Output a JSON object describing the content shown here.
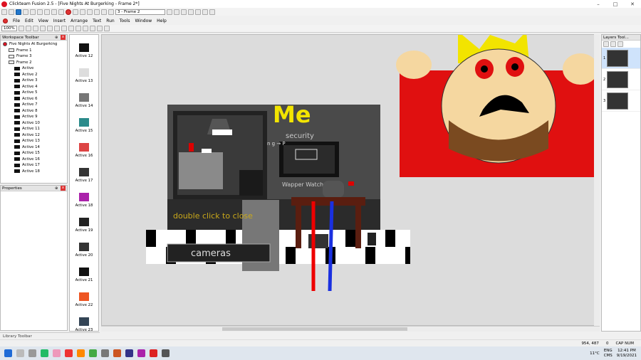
{
  "window": {
    "title": "Clickteam Fusion 2.5 - [Five Nights At Burgerking - Frame 2*]"
  },
  "toolbar": {
    "frame_select": "3 - Frame 2",
    "zoom": "100%"
  },
  "menu": [
    "File",
    "Edit",
    "View",
    "Insert",
    "Arrange",
    "Text",
    "Run",
    "Tools",
    "Window",
    "Help"
  ],
  "workspace": {
    "title": "Workspace Toolbar",
    "items": [
      {
        "label": "Five Nights At Burgerking",
        "kind": "app",
        "indent": 0
      },
      {
        "label": "Frame 1",
        "kind": "frame",
        "indent": 1
      },
      {
        "label": "Frame 3",
        "kind": "frame",
        "indent": 1
      },
      {
        "label": "Frame 2",
        "kind": "frame",
        "indent": 1
      },
      {
        "label": "Active",
        "kind": "obj",
        "indent": 2
      },
      {
        "label": "Active 2",
        "kind": "obj",
        "indent": 2
      },
      {
        "label": "Active 3",
        "kind": "obj",
        "indent": 2
      },
      {
        "label": "Active 4",
        "kind": "obj",
        "indent": 2
      },
      {
        "label": "Active 5",
        "kind": "obj",
        "indent": 2
      },
      {
        "label": "Active 6",
        "kind": "obj",
        "indent": 2
      },
      {
        "label": "Active 7",
        "kind": "obj",
        "indent": 2
      },
      {
        "label": "Active 8",
        "kind": "obj",
        "indent": 2
      },
      {
        "label": "Active 9",
        "kind": "obj",
        "indent": 2
      },
      {
        "label": "Active 10",
        "kind": "obj",
        "indent": 2
      },
      {
        "label": "Active 11",
        "kind": "obj",
        "indent": 2
      },
      {
        "label": "Active 12",
        "kind": "obj",
        "indent": 2
      },
      {
        "label": "Active 13",
        "kind": "obj",
        "indent": 2
      },
      {
        "label": "Active 14",
        "kind": "obj",
        "indent": 2
      },
      {
        "label": "Active 15",
        "kind": "obj",
        "indent": 2
      },
      {
        "label": "Active 16",
        "kind": "obj",
        "indent": 2
      },
      {
        "label": "Active 17",
        "kind": "obj",
        "indent": 2
      },
      {
        "label": "Active 18",
        "kind": "obj",
        "indent": 2
      }
    ]
  },
  "properties": {
    "title": "Properties"
  },
  "library": {
    "title": "Library Toolbar"
  },
  "objects": [
    "Active 12",
    "Active 13",
    "Active 14",
    "Active 15",
    "Active 16",
    "Active 17",
    "Active 18",
    "Active 19",
    "Active 20",
    "Active 21",
    "Active 22",
    "Active 23"
  ],
  "layers": {
    "title": "Layers Tool...",
    "items": [
      "1",
      "2",
      "3"
    ]
  },
  "scene": {
    "title_text": "Me",
    "subtitle_text": "security",
    "side_text": "n g → P",
    "sign_text": "Wapper Watchers",
    "double_click_text": "double click to close",
    "cameras_text": "cameras"
  },
  "status": {
    "coords": "954, 487",
    "zero": "0",
    "caps": "CAP NUM"
  },
  "taskbar": {
    "weather": "11°C",
    "lang1": "ENG",
    "lang2": "CMS",
    "time": "12:41 PM",
    "date": "9/19/2021"
  },
  "colors": {
    "accent": "#d12020",
    "yellow": "#e8e000",
    "skin": "#f5d7a0"
  }
}
